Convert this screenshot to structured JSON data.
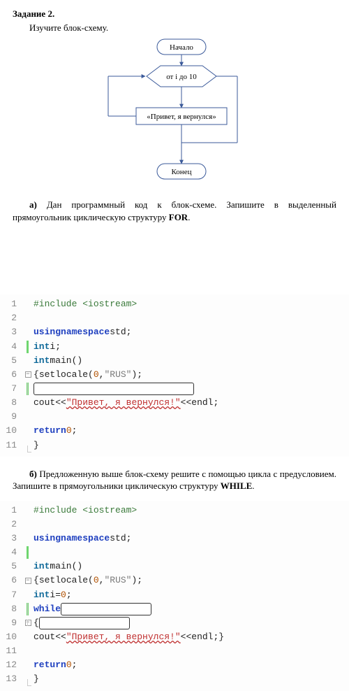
{
  "task": {
    "title": "Задание 2.",
    "subtitle": "Изучите блок-схему."
  },
  "flow": {
    "start": "Начало",
    "loop": "от i до 10",
    "body": "«Привет, я вернулся»",
    "end": "Конец"
  },
  "part_a": {
    "label": "а)",
    "text": " Дан программный код к блок-схеме. Запишите в выделенный прямоугольник циклическую структуру ",
    "kw": "FOR",
    "tail": "."
  },
  "code_a": {
    "l1": {
      "pre": "#include ",
      "hdr": "<iostream>"
    },
    "l3": {
      "kw1": "using",
      "kw2": "namespace",
      "ns": "std",
      "semi": ";"
    },
    "l4": {
      "type": "int",
      "id": "i",
      "semi": ";"
    },
    "l5": {
      "type": "int",
      "fn": "main",
      "paren": "()"
    },
    "l6": {
      "brace": "{",
      "fn": "setlocale",
      "open": "(",
      "n": "0",
      "c": ",",
      "s": "\"RUS\"",
      "close": ")",
      "semi": ";"
    },
    "l8": {
      "cout": "cout",
      "op1": "<<",
      "s": "\"Привет, я вернулся!\"",
      "op2": "<<",
      "endl": "endl",
      "semi": ";"
    },
    "l10": {
      "kw": "return",
      "n": "0",
      "semi": ";"
    },
    "l11": {
      "brace": "}"
    }
  },
  "part_b": {
    "label": "б)",
    "text": " Предложенную выше блок-схему решите с помощью цикла с предусловием. Запишите  в прямоугольники циклическую структуру ",
    "kw": "WHILE",
    "tail": "."
  },
  "code_b": {
    "l1": {
      "pre": "#include ",
      "hdr": "<iostream>"
    },
    "l3": {
      "kw1": "using",
      "kw2": "namespace",
      "ns": "std",
      "semi": ";"
    },
    "l5": {
      "type": "int",
      "fn": "main",
      "paren": "()"
    },
    "l6": {
      "brace": "{",
      "fn": "setlocale",
      "open": "(",
      "n": "0",
      "c": ",",
      "s": "\"RUS\"",
      "close": ")",
      "semi": ";"
    },
    "l7": {
      "type": "int",
      "id": "i",
      "eq": "=",
      "n": "0",
      "semi": ";"
    },
    "l8": {
      "kw": "while"
    },
    "l9": {
      "brace": "{"
    },
    "l10": {
      "cout": "cout",
      "op1": "<<",
      "s": "\"Привет, я вернулся!\"",
      "op2": "<<",
      "endl": "endl",
      "semi": ";",
      "close": "}"
    },
    "l12": {
      "kw": "return",
      "n": "0",
      "semi": ";"
    },
    "l13": {
      "brace": "}"
    }
  }
}
